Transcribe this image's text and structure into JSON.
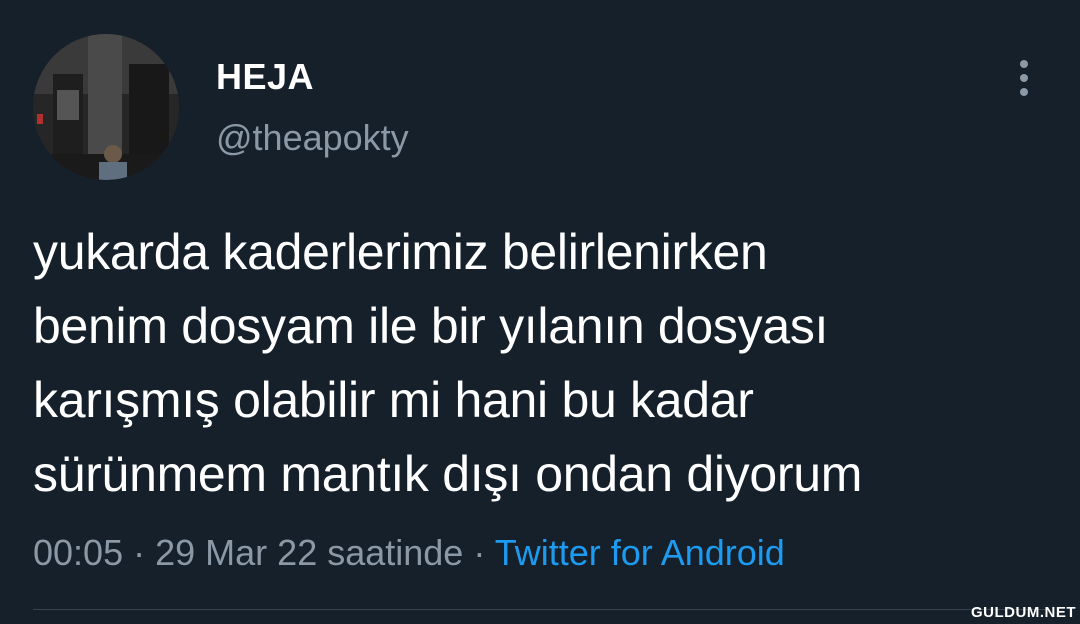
{
  "tweet": {
    "display_name": "HEJA",
    "handle": "@theapokty",
    "text": "yukarda kaderlerimiz belirlenirken\nbenim dosyam ile bir yılanın dosyası\nkarışmış olabilir mi hani bu kadar\nsürünmem mantık dışı ondan diyorum",
    "time": "00:05",
    "separator": "·",
    "date": "29 Mar 22 saatinde",
    "source": "Twitter for Android"
  },
  "watermark": "GULDUM.NET",
  "icons": {
    "more": "more-vertical-icon"
  },
  "colors": {
    "background": "#15202b",
    "primary_text": "#ffffff",
    "secondary_text": "#8b98a5",
    "link": "#1d9bf0",
    "divider": "#38444d"
  }
}
